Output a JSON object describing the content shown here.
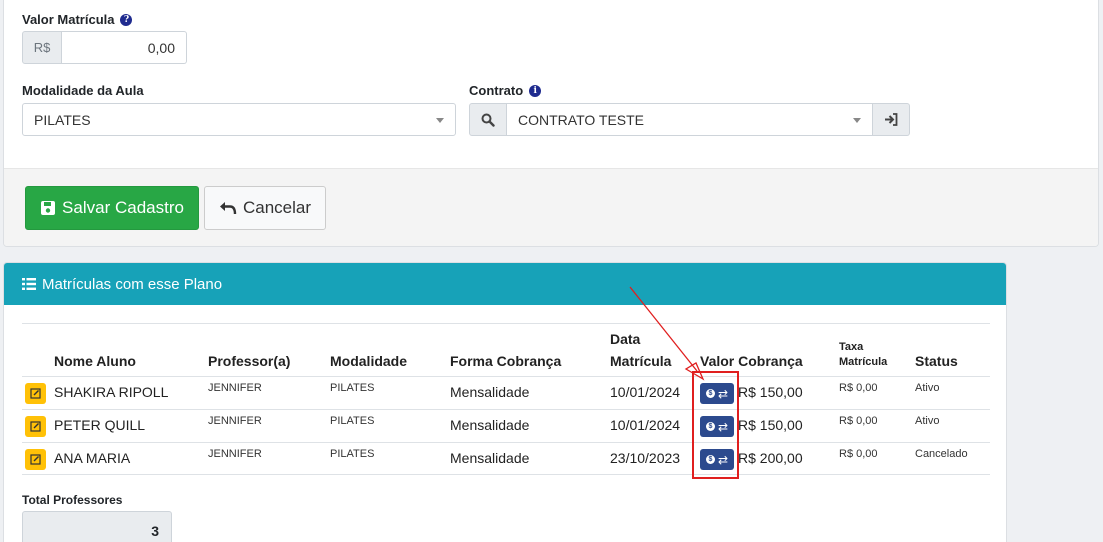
{
  "form": {
    "valor_matricula_label": "Valor Matrícula",
    "currency_prefix": "R$",
    "valor_matricula_value": "0,00",
    "modalidade_label": "Modalidade da Aula",
    "modalidade_value": "PILATES",
    "contrato_label": "Contrato",
    "contrato_value": "CONTRATO TESTE"
  },
  "actions": {
    "save_label": "Salvar Cadastro",
    "cancel_label": "Cancelar"
  },
  "enrollments": {
    "title": "Matrículas com esse Plano",
    "columns": {
      "nome": "Nome Aluno",
      "professor": "Professor(a)",
      "modalidade": "Modalidade",
      "forma": "Forma Cobrança",
      "data_line1": "Data",
      "data_line2": "Matrícula",
      "valor": "Valor Cobrança",
      "taxa_line1": "Taxa",
      "taxa_line2": "Matrícula",
      "status": "Status"
    },
    "rows": [
      {
        "nome": "SHAKIRA RIPOLL",
        "professor": "JENNIFER",
        "modalidade": "PILATES",
        "forma": "Mensalidade",
        "data": "10/01/2024",
        "valor": "R$ 150,00",
        "taxa": "R$ 0,00",
        "status": "Ativo"
      },
      {
        "nome": "PETER QUILL",
        "professor": "JENNIFER",
        "modalidade": "PILATES",
        "forma": "Mensalidade",
        "data": "10/01/2024",
        "valor": "R$ 150,00",
        "taxa": "R$ 0,00",
        "status": "Ativo"
      },
      {
        "nome": "ANA MARIA",
        "professor": "JENNIFER",
        "modalidade": "PILATES",
        "forma": "Mensalidade",
        "data": "23/10/2023",
        "valor": "R$ 200,00",
        "taxa": "R$ 0,00",
        "status": "Cancelado"
      }
    ],
    "total_label": "Total Professores",
    "total_value": "3"
  },
  "colors": {
    "header_bg": "#17a2b8",
    "save_bg": "#28a745",
    "edit_bg": "#ffc107",
    "action_bg": "#2c4a8e",
    "highlight": "#e01f1f"
  }
}
